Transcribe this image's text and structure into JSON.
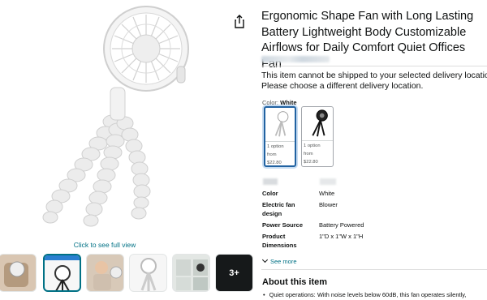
{
  "product": {
    "title": "Ergonomic Shape Fan with Long Lasting Battery Lightweight Body Customizable Airflows for Daily Comfort Quiet Offices Fan",
    "full_view_link": "Click to see full view",
    "thumbnails": [
      {
        "name": "thumb-1"
      },
      {
        "name": "thumb-2"
      },
      {
        "name": "thumb-3"
      },
      {
        "name": "thumb-4"
      },
      {
        "name": "thumb-5"
      },
      {
        "name": "thumb-6",
        "overlay": "3+"
      }
    ]
  },
  "shipping": {
    "line1": "This item cannot be shipped to your selected delivery location.",
    "line2": "Please choose a different delivery location."
  },
  "color": {
    "label": "Color:",
    "selected": "White",
    "options": [
      {
        "name": "White",
        "option_count": "1 option",
        "from": "from",
        "price": "$22.80"
      },
      {
        "name": "Black",
        "option_count": "1 option",
        "from": "from",
        "price": "$22.80"
      }
    ]
  },
  "specs": [
    {
      "name": "Color",
      "value": "White"
    },
    {
      "name": "Electric fan design",
      "value": "Blower"
    },
    {
      "name": "Power Source",
      "value": "Battery Powered"
    },
    {
      "name": "Product Dimensions",
      "value": "1\"D x 1\"W x 1\"H"
    }
  ],
  "see_more": "See more",
  "about": {
    "title": "About this item",
    "bullet": "Quiet operations: With noise levels below 60dB, this fan operates silently,"
  },
  "colors": {
    "link": "#007185",
    "selected_border": "#2162a1",
    "text": "#0f1111"
  },
  "icons": {
    "share": "share-icon",
    "chevron": "chevron-down-icon"
  }
}
